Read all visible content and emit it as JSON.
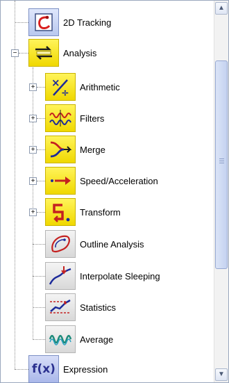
{
  "tree": {
    "items": [
      {
        "label": "2D Tracking",
        "icon": "tracking-2d-icon"
      },
      {
        "label": "Analysis",
        "icon": "analysis-icon",
        "expander": "−"
      },
      {
        "label": "Arithmetic",
        "icon": "arithmetic-icon",
        "expander": "+"
      },
      {
        "label": "Filters",
        "icon": "filters-icon",
        "expander": "+"
      },
      {
        "label": "Merge",
        "icon": "merge-icon",
        "expander": "+"
      },
      {
        "label": "Speed/Acceleration",
        "icon": "speed-acceleration-icon",
        "expander": "+"
      },
      {
        "label": "Transform",
        "icon": "transform-icon",
        "expander": "+"
      },
      {
        "label": "Outline Analysis",
        "icon": "outline-analysis-icon"
      },
      {
        "label": "Interpolate Sleeping",
        "icon": "interpolate-sleeping-icon"
      },
      {
        "label": "Statistics",
        "icon": "statistics-icon"
      },
      {
        "label": "Average",
        "icon": "average-icon"
      },
      {
        "label": "Expression",
        "icon": "expression-icon",
        "icon_text": "f(x)"
      }
    ]
  },
  "scrollbar": {
    "up_arrow": "▲",
    "down_arrow": "▼"
  },
  "colors": {
    "icon_yellow": "#f4e21a",
    "tree_line": "#8e8e8e",
    "scroll_thumb": "#c4d2f0"
  }
}
